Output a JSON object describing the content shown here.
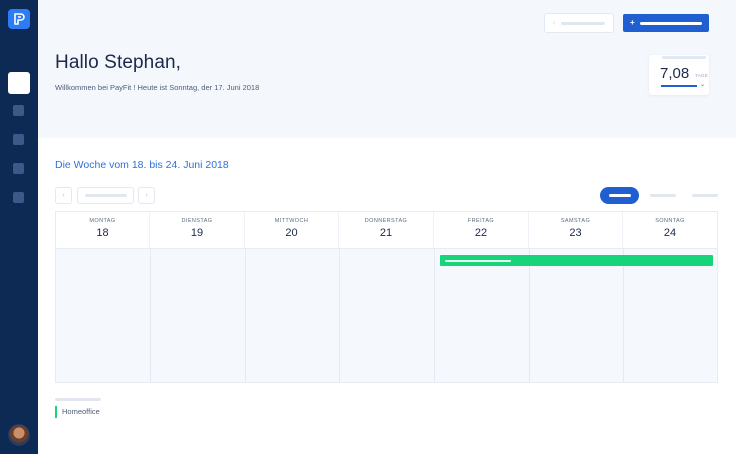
{
  "sidebar": {
    "logo_icon": "payfit-logo-icon",
    "items": [
      {
        "icon": "home-icon",
        "active": true
      },
      {
        "icon": "nav-icon",
        "active": false
      },
      {
        "icon": "nav-icon",
        "active": false
      },
      {
        "icon": "nav-icon",
        "active": false
      },
      {
        "icon": "nav-icon",
        "active": false
      }
    ],
    "avatar": "user-avatar"
  },
  "header": {
    "greeting": "Hallo Stephan,",
    "subtitle": "Willkommen bei PayFit ! Heute ist Sonntag, der 17. Juni 2018",
    "primary_button_icon": "+",
    "ghost_button_icon": "‹"
  },
  "days_card": {
    "value": "7,08",
    "unit": "TAGE",
    "caret": "⌄"
  },
  "week": {
    "title": "Die Woche vom 18. bis 24. Juni 2018",
    "prev_icon": "‹",
    "next_icon": "›"
  },
  "calendar": {
    "days": [
      {
        "name": "MONTAG",
        "num": "18"
      },
      {
        "name": "DIENSTAG",
        "num": "19"
      },
      {
        "name": "MITTWOCH",
        "num": "20"
      },
      {
        "name": "DONNERSTAG",
        "num": "21"
      },
      {
        "name": "FREITAG",
        "num": "22"
      },
      {
        "name": "SAMSTAG",
        "num": "23"
      },
      {
        "name": "SONNTAG",
        "num": "24"
      }
    ],
    "event": {
      "type": "Homeoffice",
      "from": "FREITAG",
      "to": "SONNTAG",
      "color": "#17d47a"
    }
  },
  "legend": {
    "label": "Homeoffice",
    "color": "#17d47a"
  },
  "colors": {
    "sidebar": "#0d2a55",
    "accent": "#1f5fd1",
    "link": "#2d72d9",
    "event": "#17d47a"
  }
}
